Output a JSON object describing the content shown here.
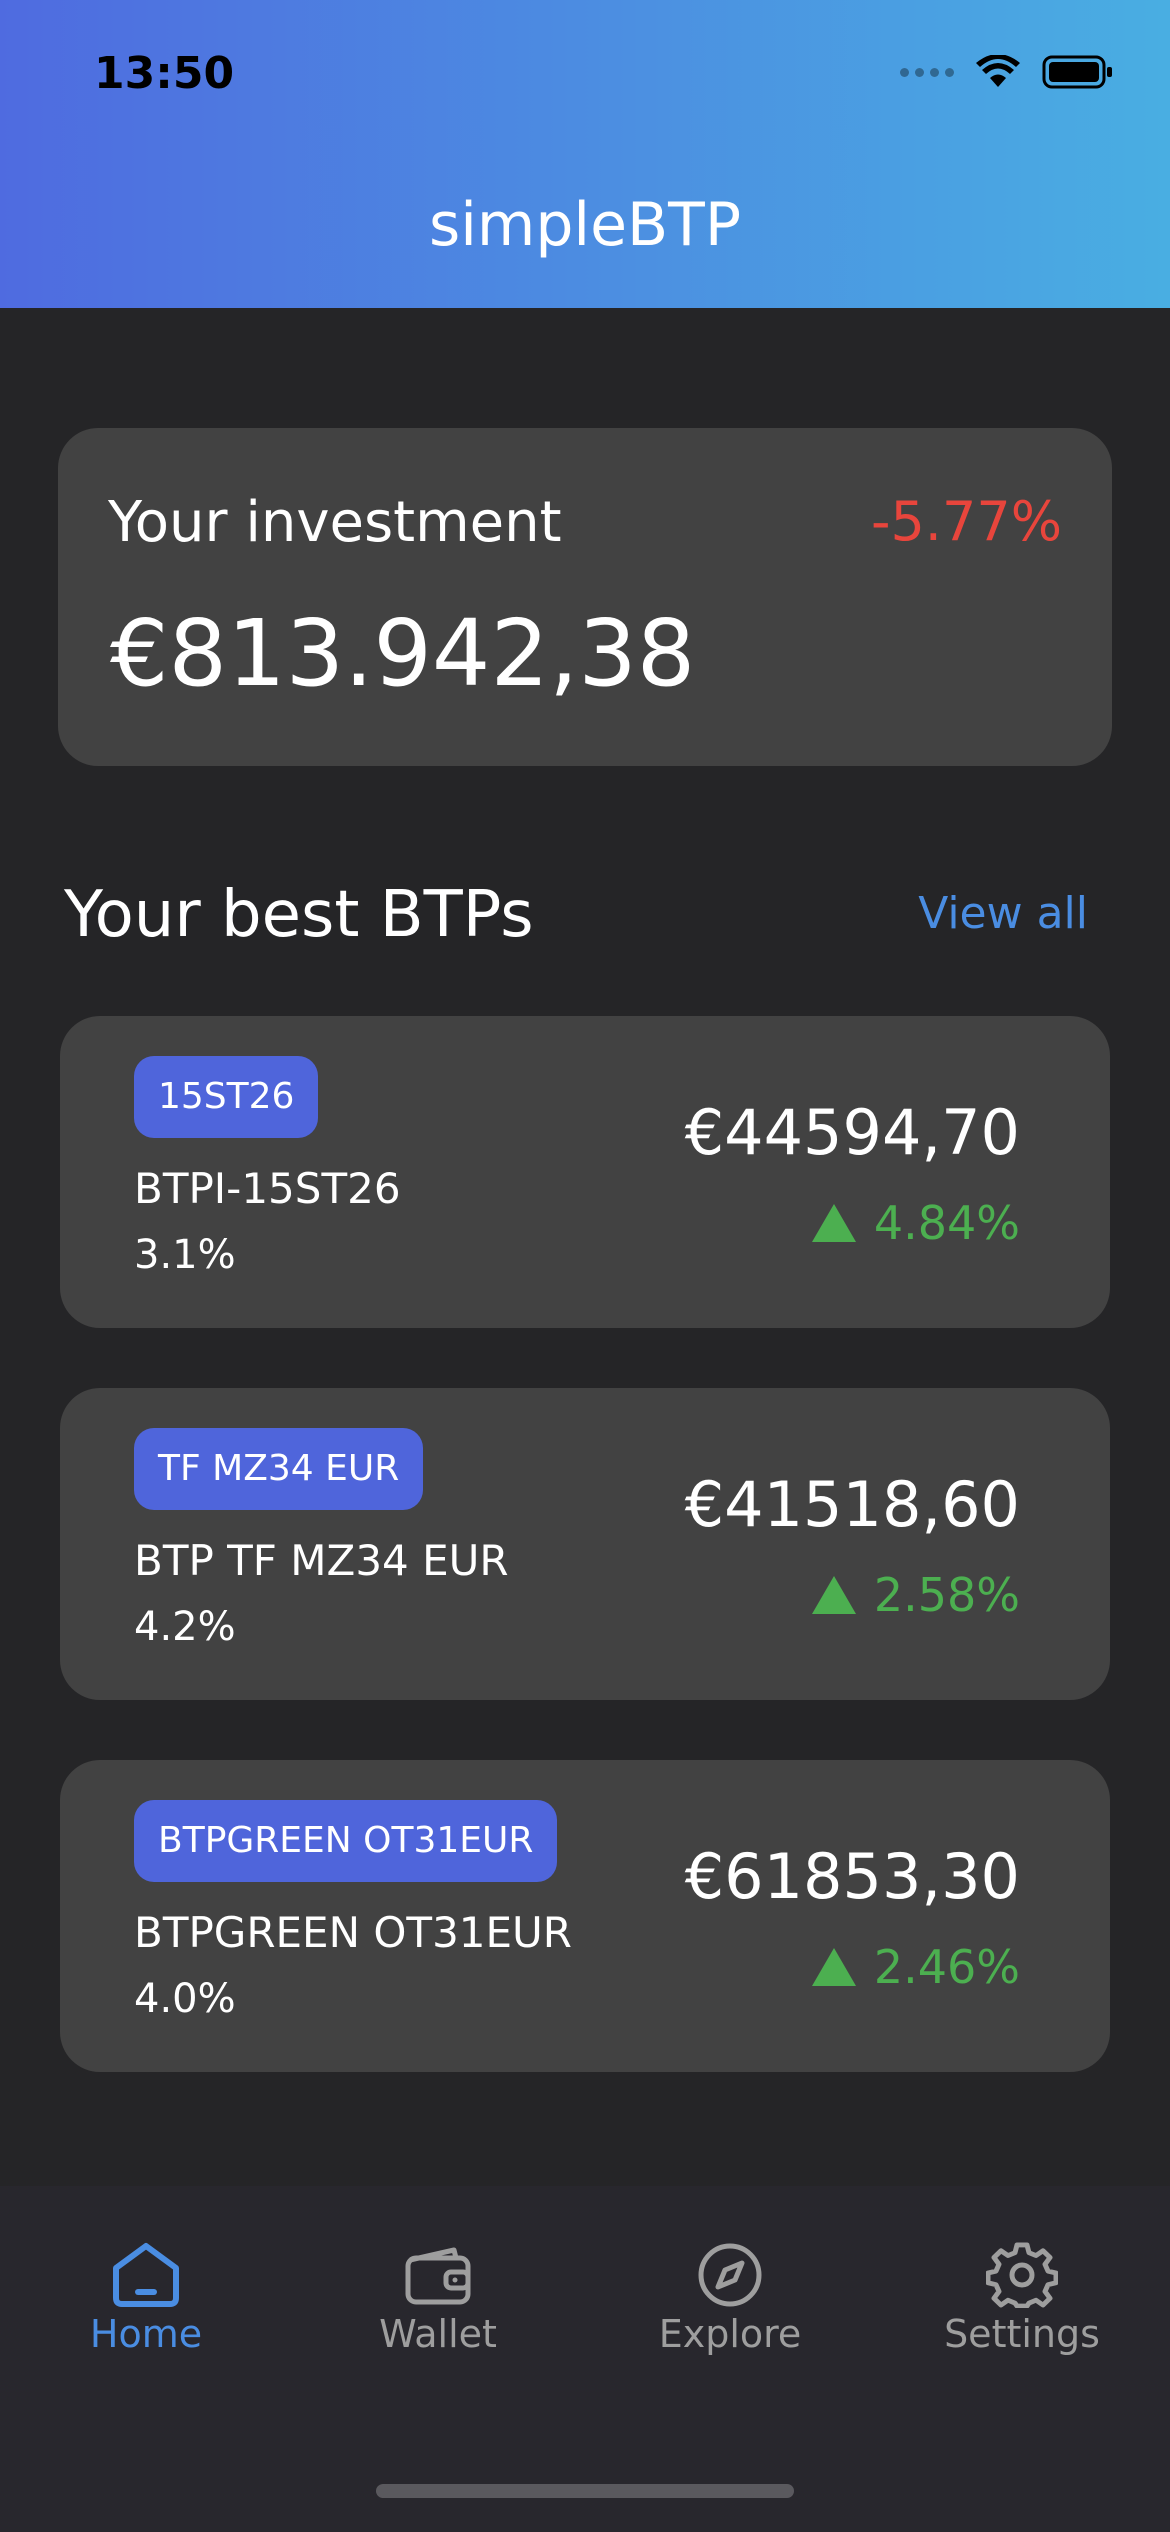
{
  "status_bar": {
    "time": "13:50"
  },
  "header": {
    "title": "simpleBTP"
  },
  "investment": {
    "label": "Your investment",
    "value": "€813.942,38",
    "change": "-5.77%"
  },
  "best_btps": {
    "title": "Your best BTPs",
    "view_all": "View all",
    "items": [
      {
        "badge": "15ST26",
        "name": "BTPI-15ST26",
        "rate": "3.1%",
        "price": "€44594,70",
        "change": "4.84%"
      },
      {
        "badge": "TF MZ34 EUR",
        "name": "BTP TF MZ34 EUR",
        "rate": "4.2%",
        "price": "€41518,60",
        "change": "2.58%"
      },
      {
        "badge": "BTPGREEN OT31EUR",
        "name": "BTPGREEN OT31EUR",
        "rate": "4.0%",
        "price": "€61853,30",
        "change": "2.46%"
      }
    ]
  },
  "tabbar": {
    "items": [
      {
        "label": "Home",
        "icon": "home-icon",
        "active": true
      },
      {
        "label": "Wallet",
        "icon": "wallet-icon",
        "active": false
      },
      {
        "label": "Explore",
        "icon": "compass-icon",
        "active": false
      },
      {
        "label": "Settings",
        "icon": "gear-icon",
        "active": false
      }
    ]
  },
  "colors": {
    "accent": "#4a8de2",
    "badge": "#4f65db",
    "negative": "#e8453c",
    "positive": "#4caf50",
    "card": "#424242",
    "background": "#252527"
  }
}
